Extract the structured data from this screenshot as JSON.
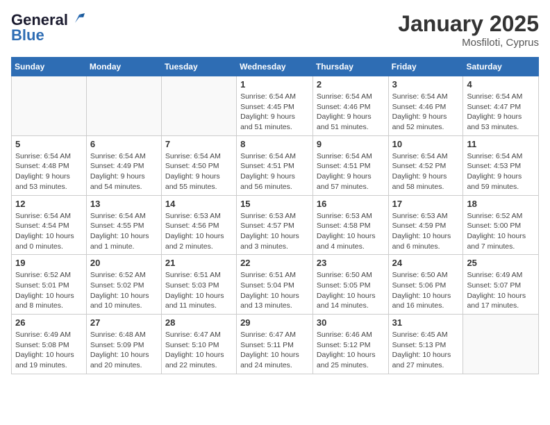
{
  "header": {
    "logo_line1": "General",
    "logo_line2": "Blue",
    "month": "January 2025",
    "location": "Mosfiloti, Cyprus"
  },
  "days_of_week": [
    "Sunday",
    "Monday",
    "Tuesday",
    "Wednesday",
    "Thursday",
    "Friday",
    "Saturday"
  ],
  "weeks": [
    [
      {
        "num": "",
        "info": ""
      },
      {
        "num": "",
        "info": ""
      },
      {
        "num": "",
        "info": ""
      },
      {
        "num": "1",
        "info": "Sunrise: 6:54 AM\nSunset: 4:45 PM\nDaylight: 9 hours and 51 minutes."
      },
      {
        "num": "2",
        "info": "Sunrise: 6:54 AM\nSunset: 4:46 PM\nDaylight: 9 hours and 51 minutes."
      },
      {
        "num": "3",
        "info": "Sunrise: 6:54 AM\nSunset: 4:46 PM\nDaylight: 9 hours and 52 minutes."
      },
      {
        "num": "4",
        "info": "Sunrise: 6:54 AM\nSunset: 4:47 PM\nDaylight: 9 hours and 53 minutes."
      }
    ],
    [
      {
        "num": "5",
        "info": "Sunrise: 6:54 AM\nSunset: 4:48 PM\nDaylight: 9 hours and 53 minutes."
      },
      {
        "num": "6",
        "info": "Sunrise: 6:54 AM\nSunset: 4:49 PM\nDaylight: 9 hours and 54 minutes."
      },
      {
        "num": "7",
        "info": "Sunrise: 6:54 AM\nSunset: 4:50 PM\nDaylight: 9 hours and 55 minutes."
      },
      {
        "num": "8",
        "info": "Sunrise: 6:54 AM\nSunset: 4:51 PM\nDaylight: 9 hours and 56 minutes."
      },
      {
        "num": "9",
        "info": "Sunrise: 6:54 AM\nSunset: 4:51 PM\nDaylight: 9 hours and 57 minutes."
      },
      {
        "num": "10",
        "info": "Sunrise: 6:54 AM\nSunset: 4:52 PM\nDaylight: 9 hours and 58 minutes."
      },
      {
        "num": "11",
        "info": "Sunrise: 6:54 AM\nSunset: 4:53 PM\nDaylight: 9 hours and 59 minutes."
      }
    ],
    [
      {
        "num": "12",
        "info": "Sunrise: 6:54 AM\nSunset: 4:54 PM\nDaylight: 10 hours and 0 minutes."
      },
      {
        "num": "13",
        "info": "Sunrise: 6:54 AM\nSunset: 4:55 PM\nDaylight: 10 hours and 1 minute."
      },
      {
        "num": "14",
        "info": "Sunrise: 6:53 AM\nSunset: 4:56 PM\nDaylight: 10 hours and 2 minutes."
      },
      {
        "num": "15",
        "info": "Sunrise: 6:53 AM\nSunset: 4:57 PM\nDaylight: 10 hours and 3 minutes."
      },
      {
        "num": "16",
        "info": "Sunrise: 6:53 AM\nSunset: 4:58 PM\nDaylight: 10 hours and 4 minutes."
      },
      {
        "num": "17",
        "info": "Sunrise: 6:53 AM\nSunset: 4:59 PM\nDaylight: 10 hours and 6 minutes."
      },
      {
        "num": "18",
        "info": "Sunrise: 6:52 AM\nSunset: 5:00 PM\nDaylight: 10 hours and 7 minutes."
      }
    ],
    [
      {
        "num": "19",
        "info": "Sunrise: 6:52 AM\nSunset: 5:01 PM\nDaylight: 10 hours and 8 minutes."
      },
      {
        "num": "20",
        "info": "Sunrise: 6:52 AM\nSunset: 5:02 PM\nDaylight: 10 hours and 10 minutes."
      },
      {
        "num": "21",
        "info": "Sunrise: 6:51 AM\nSunset: 5:03 PM\nDaylight: 10 hours and 11 minutes."
      },
      {
        "num": "22",
        "info": "Sunrise: 6:51 AM\nSunset: 5:04 PM\nDaylight: 10 hours and 13 minutes."
      },
      {
        "num": "23",
        "info": "Sunrise: 6:50 AM\nSunset: 5:05 PM\nDaylight: 10 hours and 14 minutes."
      },
      {
        "num": "24",
        "info": "Sunrise: 6:50 AM\nSunset: 5:06 PM\nDaylight: 10 hours and 16 minutes."
      },
      {
        "num": "25",
        "info": "Sunrise: 6:49 AM\nSunset: 5:07 PM\nDaylight: 10 hours and 17 minutes."
      }
    ],
    [
      {
        "num": "26",
        "info": "Sunrise: 6:49 AM\nSunset: 5:08 PM\nDaylight: 10 hours and 19 minutes."
      },
      {
        "num": "27",
        "info": "Sunrise: 6:48 AM\nSunset: 5:09 PM\nDaylight: 10 hours and 20 minutes."
      },
      {
        "num": "28",
        "info": "Sunrise: 6:47 AM\nSunset: 5:10 PM\nDaylight: 10 hours and 22 minutes."
      },
      {
        "num": "29",
        "info": "Sunrise: 6:47 AM\nSunset: 5:11 PM\nDaylight: 10 hours and 24 minutes."
      },
      {
        "num": "30",
        "info": "Sunrise: 6:46 AM\nSunset: 5:12 PM\nDaylight: 10 hours and 25 minutes."
      },
      {
        "num": "31",
        "info": "Sunrise: 6:45 AM\nSunset: 5:13 PM\nDaylight: 10 hours and 27 minutes."
      },
      {
        "num": "",
        "info": ""
      }
    ]
  ]
}
